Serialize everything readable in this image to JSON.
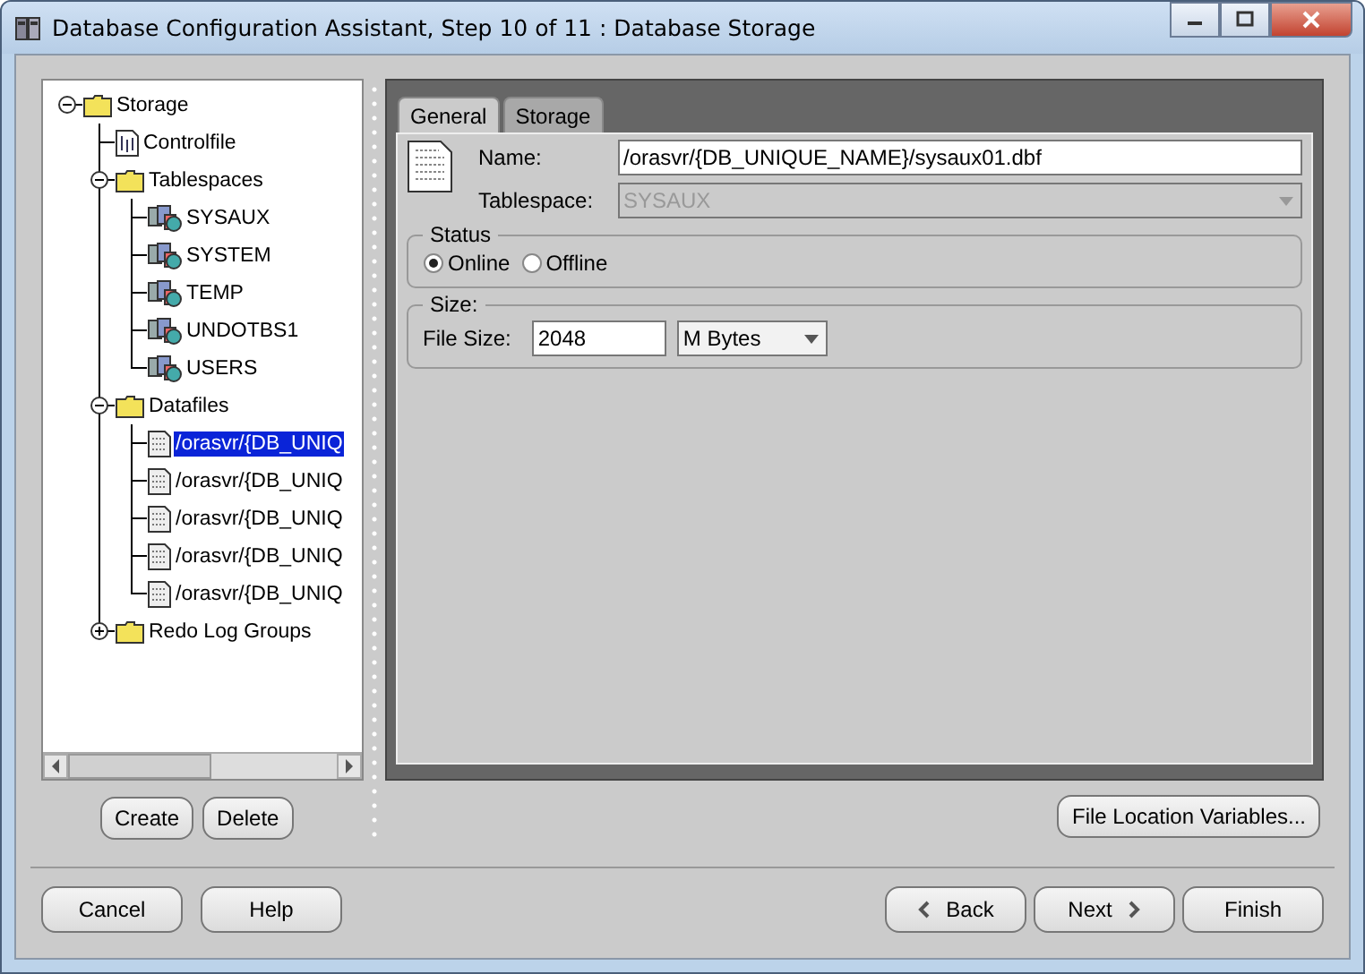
{
  "window": {
    "title": "Database Configuration Assistant, Step 10 of 11 : Database Storage"
  },
  "tree": [
    {
      "label": "Storage",
      "kind": "folder",
      "expanded": true,
      "selected": false,
      "children": [
        {
          "label": "Controlfile",
          "kind": "controlfile",
          "selected": false
        },
        {
          "label": "Tablespaces",
          "kind": "folder",
          "expanded": true,
          "selected": false,
          "children": [
            {
              "label": "SYSAUX",
              "kind": "tablespace",
              "selected": false
            },
            {
              "label": "SYSTEM",
              "kind": "tablespace",
              "selected": false
            },
            {
              "label": "TEMP",
              "kind": "tablespace",
              "selected": false
            },
            {
              "label": "UNDOTBS1",
              "kind": "tablespace",
              "selected": false
            },
            {
              "label": "USERS",
              "kind": "tablespace",
              "selected": false
            }
          ]
        },
        {
          "label": "Datafiles",
          "kind": "folder",
          "expanded": true,
          "selected": false,
          "children": [
            {
              "label": "/orasvr/{DB_UNIQ",
              "kind": "datafile",
              "selected": true
            },
            {
              "label": "/orasvr/{DB_UNIQ",
              "kind": "datafile",
              "selected": false
            },
            {
              "label": "/orasvr/{DB_UNIQ",
              "kind": "datafile",
              "selected": false
            },
            {
              "label": "/orasvr/{DB_UNIQ",
              "kind": "datafile",
              "selected": false
            },
            {
              "label": "/orasvr/{DB_UNIQ",
              "kind": "datafile",
              "selected": false
            }
          ]
        },
        {
          "label": "Redo Log Groups",
          "kind": "folder",
          "expanded": false,
          "selected": false
        }
      ]
    }
  ],
  "tree_buttons": [
    "Create",
    "Delete"
  ],
  "tabs": [
    {
      "label": "General",
      "selected": true
    },
    {
      "label": "Storage",
      "selected": false
    }
  ],
  "name_field": {
    "label": "Name:",
    "value": "/orasvr/{DB_UNIQUE_NAME}/sysaux01.dbf"
  },
  "tablespace_field": {
    "label": "Tablespace:",
    "value": "SYSAUX",
    "disabled": true
  },
  "status_group": {
    "title": "Status",
    "options": [
      {
        "label": "Online",
        "selected": true
      },
      {
        "label": "Offline",
        "selected": false
      }
    ]
  },
  "size_group": {
    "title": "Size:",
    "label": "File Size:",
    "value": "2048",
    "unit": "M Bytes"
  },
  "file_location_button": "File Location Variables...",
  "footer_left": [
    "Cancel",
    "Help"
  ],
  "footer_right": [
    {
      "label": "Back",
      "kind": "back"
    },
    {
      "label": "Next",
      "kind": "next"
    },
    {
      "label": "Finish",
      "kind": "plain"
    }
  ]
}
